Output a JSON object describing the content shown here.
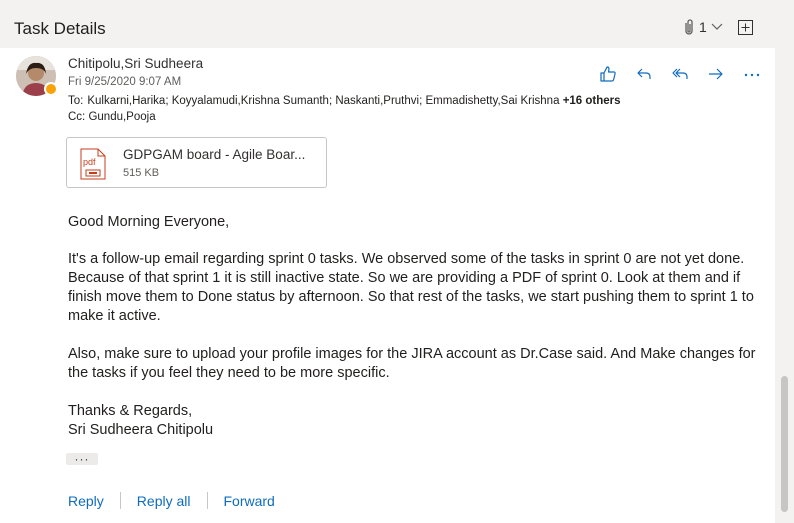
{
  "header": {
    "title": "Task Details",
    "attachment_count": "1",
    "attachment_icon": "paperclip-icon",
    "expand_icon": "expand-window-icon"
  },
  "message": {
    "sender": "Chitipolu,Sri Sudheera",
    "date": "Fri 9/25/2020 9:07 AM",
    "to_label": "To:",
    "to": "Kulkarni,Harika; Koyyalamudi,Krishna Sumanth; Naskanti,Pruthvi; Emmadishetty,Sai Krishna",
    "to_more": "+16 others",
    "cc_label": "Cc:",
    "cc": "Gundu,Pooja",
    "status_color": "#f8a20a"
  },
  "actions": [
    "like-icon",
    "reply-icon",
    "reply-all-icon",
    "forward-icon",
    "more-icon"
  ],
  "attachment": {
    "name": "GDPGAM board - Agile Boar...",
    "size": "515 KB",
    "type_label": "pdf"
  },
  "body": {
    "greeting": "Good Morning Everyone,",
    "p1": "It's a follow-up email regarding sprint 0 tasks. We observed some of the tasks in sprint 0 are not yet done. Because of that sprint 1 it is still inactive state. So we are providing a PDF of sprint 0. Look at them and if finish move them to Done status by afternoon. So that rest of the tasks, we start pushing them to sprint 1 to make it active.",
    "p2": "Also, make sure to upload your profile images for the JIRA account as Dr.Case said. And Make changes for the tasks if you feel they need to be more specific.",
    "signoff": "Thanks & Regards,",
    "signature": "Sri Sudheera Chitipolu",
    "expand_ellipsis": "···"
  },
  "footer": {
    "reply": "Reply",
    "reply_all": "Reply all",
    "forward": "Forward"
  },
  "colors": {
    "accent": "#0f6cbd",
    "pdf_red": "#c43e1c"
  }
}
